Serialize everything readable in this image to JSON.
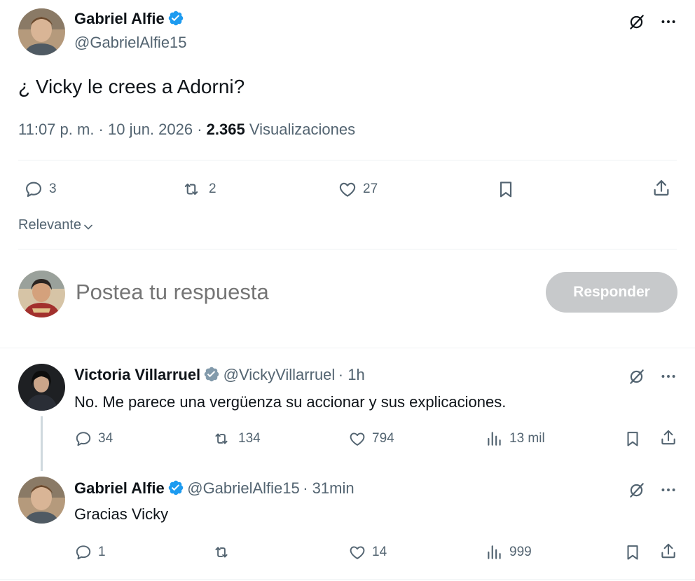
{
  "main_tweet": {
    "author_name": "Gabriel Alfie",
    "author_handle": "@GabrielAlfie15",
    "text": "¿ Vicky le crees a Adorni?",
    "time": "11:07 p. m. · 10 jun. 2026 · ",
    "views_count": "2.365",
    "views_label": "Visualizaciones",
    "replies": "3",
    "retweets": "2",
    "likes": "27"
  },
  "sort_label": "Relevante",
  "composer": {
    "placeholder": "Postea tu respuesta",
    "button_label": "Responder"
  },
  "replies": [
    {
      "author_name": "Victoria Villarruel",
      "author_handle": "@VickyVillarruel",
      "time": "· 1h",
      "text": "No. Me parece una vergüenza su accionar y sus explicaciones.",
      "replies": "34",
      "retweets": "134",
      "likes": "794",
      "views": "13 mil",
      "verified_color": "#829aab"
    },
    {
      "author_name": "Gabriel Alfie",
      "author_handle": "@GabrielAlfie15",
      "time": "· 31min",
      "text": "Gracias Vicky",
      "replies": "1",
      "retweets": "",
      "likes": "14",
      "views": "999",
      "verified_color": "#1d9bf0"
    }
  ],
  "colors": {
    "verified_blue": "#1d9bf0",
    "gray_text": "#536471",
    "button_disabled": "#c7c9cb"
  }
}
